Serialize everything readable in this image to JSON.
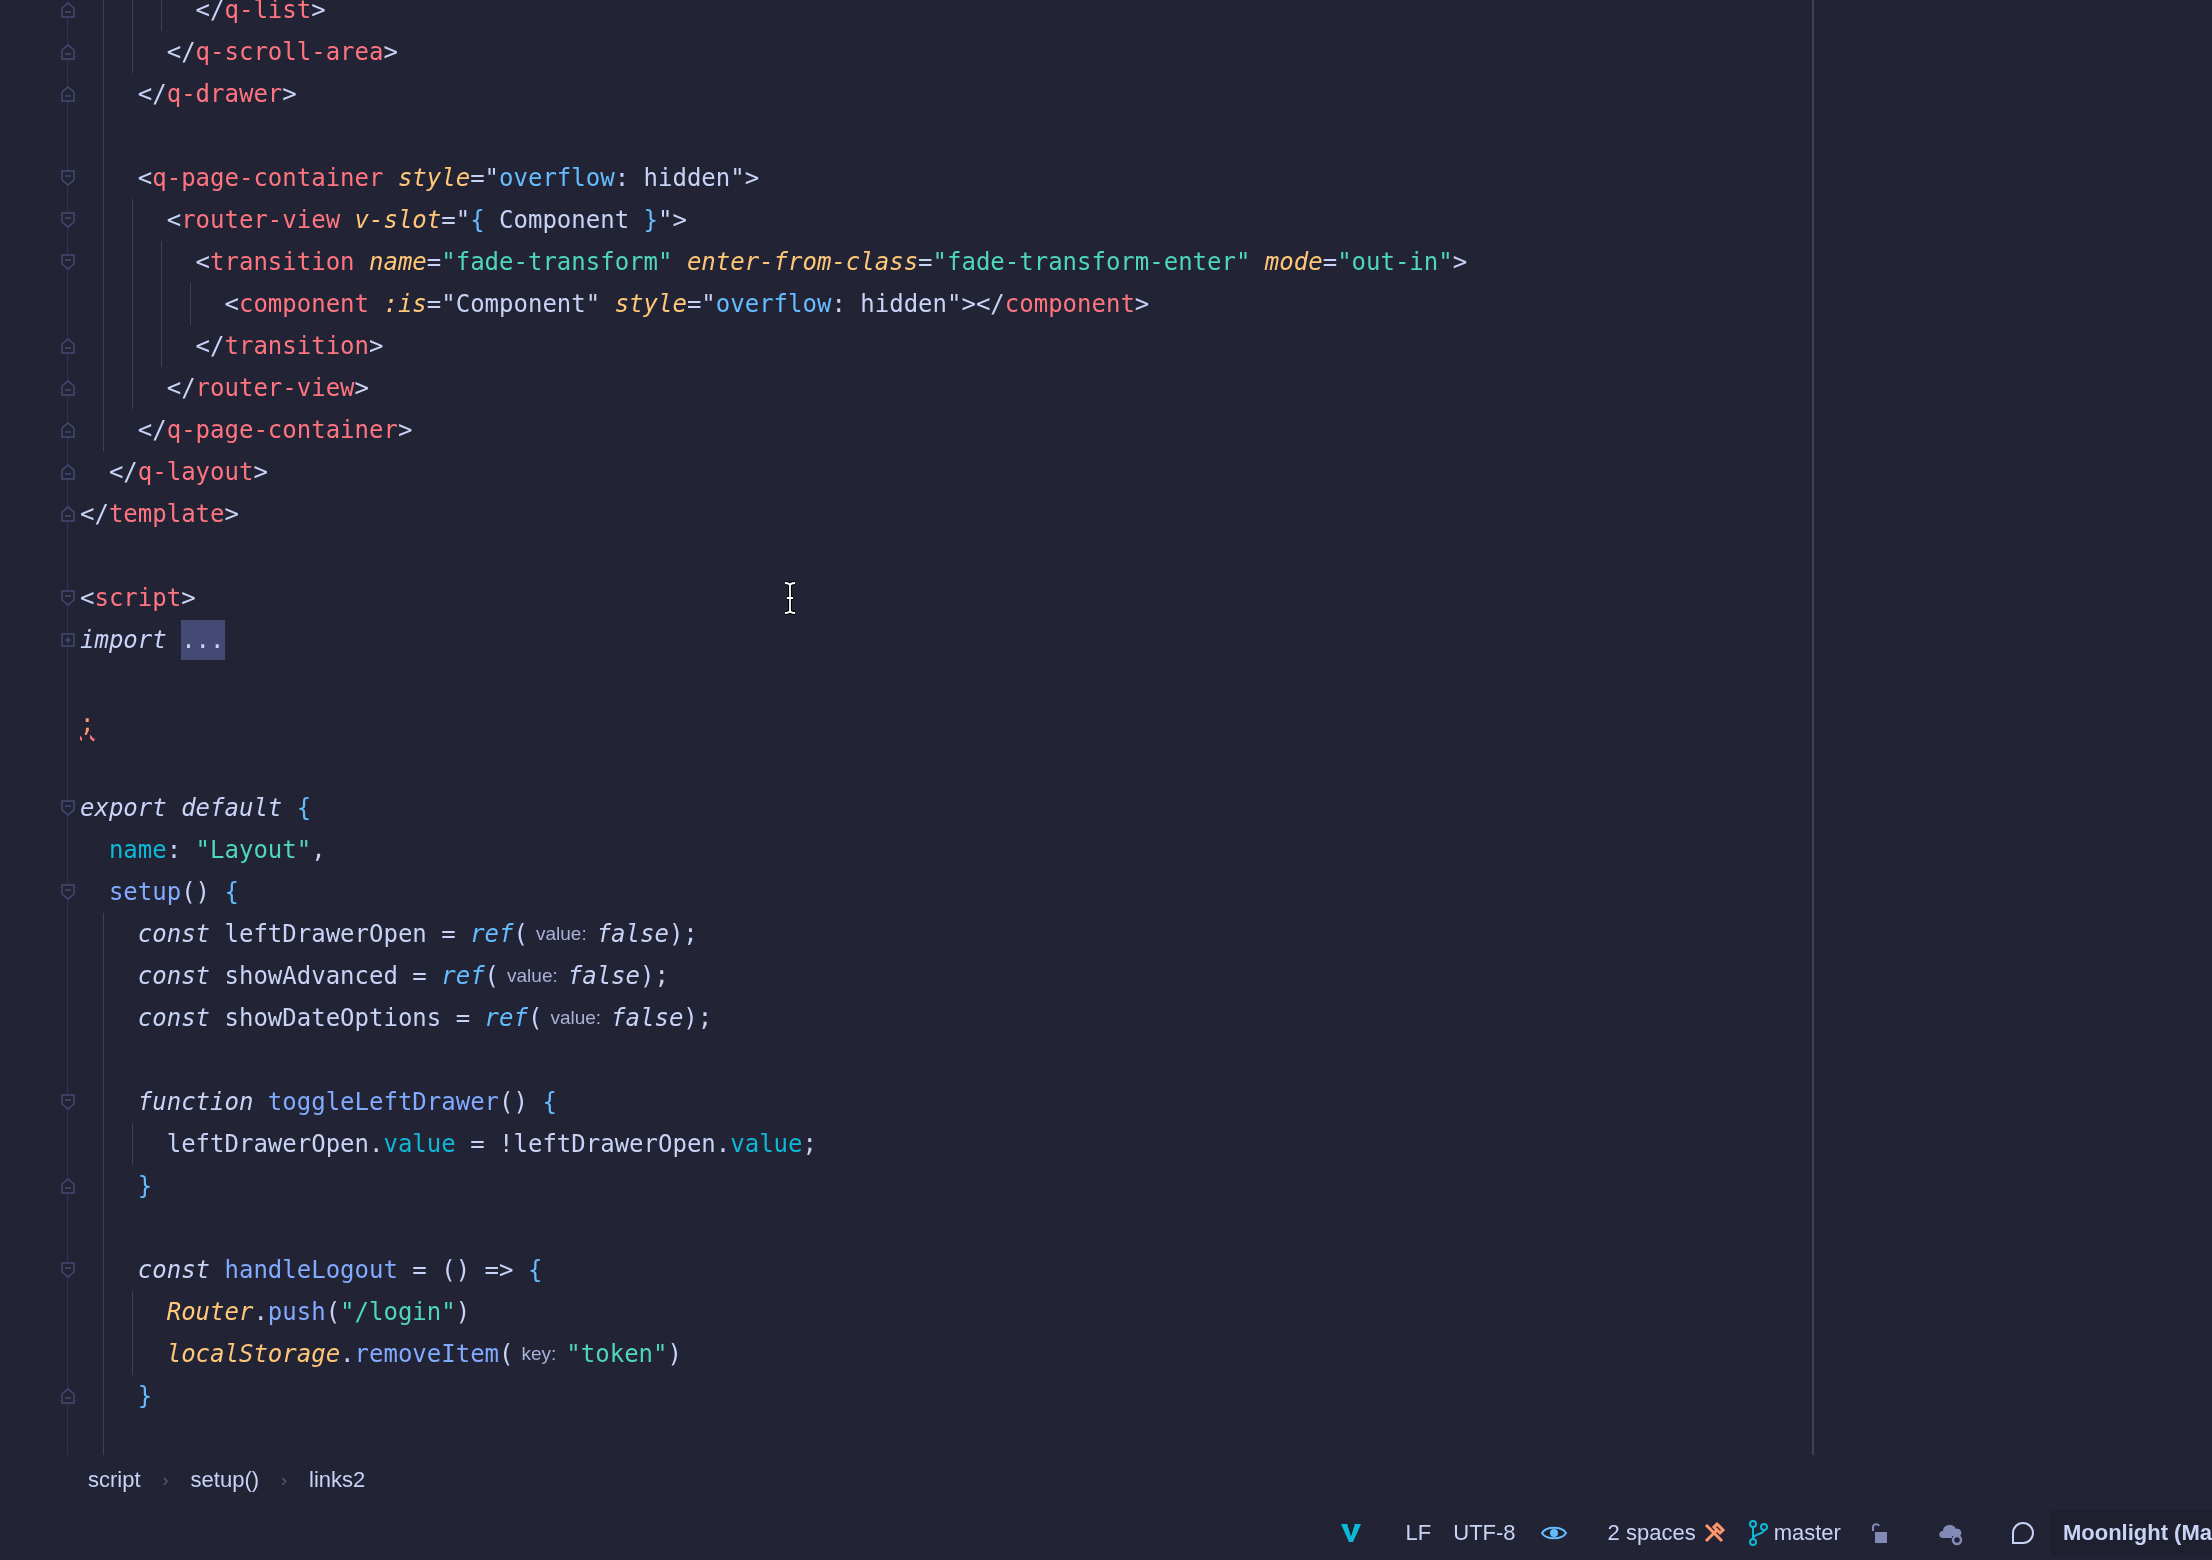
{
  "editor": {
    "lines": [
      {
        "kind": "closer",
        "tokens": [
          {
            "kind": "punct",
            "text": "        </"
          },
          {
            "kind": "tag",
            "text": "q-list"
          },
          {
            "kind": "punct",
            "text": ">"
          }
        ]
      },
      {
        "kind": "closer",
        "tokens": [
          {
            "kind": "punct",
            "text": "      </"
          },
          {
            "kind": "tag",
            "text": "q-scroll-area"
          },
          {
            "kind": "punct",
            "text": ">"
          }
        ]
      },
      {
        "kind": "closer",
        "tokens": [
          {
            "kind": "punct",
            "text": "    </"
          },
          {
            "kind": "tag",
            "text": "q-drawer"
          },
          {
            "kind": "punct",
            "text": ">"
          }
        ]
      },
      {
        "kind": "blank"
      },
      {
        "kind": "opener",
        "tokens": [
          {
            "kind": "punct",
            "text": "    <"
          },
          {
            "kind": "tag",
            "text": "q-page-container"
          },
          {
            "kind": "attr",
            "text": " style"
          },
          {
            "kind": "punct",
            "text": "=\""
          },
          {
            "kind": "cssprop",
            "text": "overflow"
          },
          {
            "kind": "plain",
            "text": ": hidden"
          },
          {
            "kind": "punct",
            "text": "\">"
          }
        ]
      },
      {
        "kind": "opener",
        "tokens": [
          {
            "kind": "punct",
            "text": "      <"
          },
          {
            "kind": "tag",
            "text": "router-view"
          },
          {
            "kind": "attr",
            "text": " v-slot"
          },
          {
            "kind": "punct",
            "text": "=\""
          },
          {
            "kind": "brace",
            "text": "{"
          },
          {
            "kind": "plain",
            "text": " Component "
          },
          {
            "kind": "brace",
            "text": "}"
          },
          {
            "kind": "punct",
            "text": "\">"
          }
        ]
      },
      {
        "kind": "opener",
        "tokens": [
          {
            "kind": "punct",
            "text": "        <"
          },
          {
            "kind": "tag",
            "text": "transition"
          },
          {
            "kind": "attr",
            "text": " name"
          },
          {
            "kind": "punct",
            "text": "="
          },
          {
            "kind": "string",
            "text": "\"fade-transform\""
          },
          {
            "kind": "attr",
            "text": " enter-from-class"
          },
          {
            "kind": "punct",
            "text": "="
          },
          {
            "kind": "string",
            "text": "\"fade-transform-enter\""
          },
          {
            "kind": "attr",
            "text": " mode"
          },
          {
            "kind": "punct",
            "text": "="
          },
          {
            "kind": "string",
            "text": "\"out-in\""
          },
          {
            "kind": "punct",
            "text": ">"
          }
        ]
      },
      {
        "kind": "plain",
        "tokens": [
          {
            "kind": "punct",
            "text": "          <"
          },
          {
            "kind": "tag",
            "text": "component"
          },
          {
            "kind": "attr",
            "text": " :is"
          },
          {
            "kind": "punct",
            "text": "="
          },
          {
            "kind": "plain",
            "text": "\"Component\""
          },
          {
            "kind": "attr",
            "text": " style"
          },
          {
            "kind": "punct",
            "text": "=\""
          },
          {
            "kind": "cssprop",
            "text": "overflow"
          },
          {
            "kind": "plain",
            "text": ": hidden"
          },
          {
            "kind": "punct",
            "text": "\"></"
          },
          {
            "kind": "tag",
            "text": "component"
          },
          {
            "kind": "punct",
            "text": ">"
          }
        ]
      },
      {
        "kind": "closer",
        "tokens": [
          {
            "kind": "punct",
            "text": "        </"
          },
          {
            "kind": "tag",
            "text": "transition"
          },
          {
            "kind": "punct",
            "text": ">"
          }
        ]
      },
      {
        "kind": "closer",
        "tokens": [
          {
            "kind": "punct",
            "text": "      </"
          },
          {
            "kind": "tag",
            "text": "router-view"
          },
          {
            "kind": "punct",
            "text": ">"
          }
        ]
      },
      {
        "kind": "closer",
        "tokens": [
          {
            "kind": "punct",
            "text": "    </"
          },
          {
            "kind": "tag",
            "text": "q-page-container"
          },
          {
            "kind": "punct",
            "text": ">"
          }
        ]
      },
      {
        "kind": "closer",
        "tokens": [
          {
            "kind": "punct",
            "text": "  </"
          },
          {
            "kind": "tag",
            "text": "q-layout"
          },
          {
            "kind": "punct",
            "text": ">"
          }
        ]
      },
      {
        "kind": "closer",
        "tokens": [
          {
            "kind": "punct",
            "text": "</"
          },
          {
            "kind": "tag",
            "text": "template"
          },
          {
            "kind": "punct",
            "text": ">"
          }
        ]
      },
      {
        "kind": "blank"
      },
      {
        "kind": "opener",
        "tokens": [
          {
            "kind": "punct",
            "text": "<"
          },
          {
            "kind": "tag",
            "text": "script"
          },
          {
            "kind": "punct",
            "text": ">"
          }
        ]
      },
      {
        "kind": "collapsed",
        "tokens": [
          {
            "kind": "keyword",
            "text": "import "
          },
          {
            "kind": "folded",
            "text": "..."
          }
        ]
      },
      {
        "kind": "blank"
      },
      {
        "kind": "plain",
        "tokens": [
          {
            "kind": "error",
            "text": ";"
          }
        ]
      },
      {
        "kind": "blank"
      },
      {
        "kind": "opener",
        "tokens": [
          {
            "kind": "keyword",
            "text": "export default "
          },
          {
            "kind": "brace",
            "text": "{"
          }
        ]
      },
      {
        "kind": "plain",
        "tokens": [
          {
            "kind": "property",
            "text": "  name"
          },
          {
            "kind": "punct",
            "text": ": "
          },
          {
            "kind": "string",
            "text": "\"Layout\""
          },
          {
            "kind": "punct",
            "text": ","
          }
        ]
      },
      {
        "kind": "opener",
        "tokens": [
          {
            "kind": "function",
            "text": "  setup"
          },
          {
            "kind": "punct",
            "text": "() "
          },
          {
            "kind": "brace",
            "text": "{"
          }
        ]
      },
      {
        "kind": "plain",
        "tokens": [
          {
            "kind": "keyword",
            "text": "    const"
          },
          {
            "kind": "plain",
            "text": " leftDrawerOpen = "
          },
          {
            "kind": "call",
            "text": "ref"
          },
          {
            "kind": "punct",
            "text": "("
          },
          {
            "kind": "hint",
            "text": "value:"
          },
          {
            "kind": "literal",
            "text": "false"
          },
          {
            "kind": "punct",
            "text": ");"
          }
        ]
      },
      {
        "kind": "plain",
        "tokens": [
          {
            "kind": "keyword",
            "text": "    const"
          },
          {
            "kind": "plain",
            "text": " showAdvanced = "
          },
          {
            "kind": "call",
            "text": "ref"
          },
          {
            "kind": "punct",
            "text": "("
          },
          {
            "kind": "hint",
            "text": "value:"
          },
          {
            "kind": "literal",
            "text": "false"
          },
          {
            "kind": "punct",
            "text": ");"
          }
        ]
      },
      {
        "kind": "plain",
        "tokens": [
          {
            "kind": "keyword",
            "text": "    const"
          },
          {
            "kind": "plain",
            "text": " showDateOptions = "
          },
          {
            "kind": "call",
            "text": "ref"
          },
          {
            "kind": "punct",
            "text": "("
          },
          {
            "kind": "hint",
            "text": "value:"
          },
          {
            "kind": "literal",
            "text": "false"
          },
          {
            "kind": "punct",
            "text": ");"
          }
        ]
      },
      {
        "kind": "blank"
      },
      {
        "kind": "opener",
        "tokens": [
          {
            "kind": "keyword",
            "text": "    function "
          },
          {
            "kind": "function",
            "text": "toggleLeftDrawer"
          },
          {
            "kind": "punct",
            "text": "() "
          },
          {
            "kind": "brace",
            "text": "{"
          }
        ]
      },
      {
        "kind": "plain",
        "tokens": [
          {
            "kind": "plain",
            "text": "      leftDrawerOpen."
          },
          {
            "kind": "property",
            "text": "value"
          },
          {
            "kind": "plain",
            "text": " = !leftDrawerOpen."
          },
          {
            "kind": "property",
            "text": "value"
          },
          {
            "kind": "plain",
            "text": ";"
          }
        ]
      },
      {
        "kind": "closer",
        "tokens": [
          {
            "kind": "brace",
            "text": "    }"
          }
        ]
      },
      {
        "kind": "blank"
      },
      {
        "kind": "opener",
        "tokens": [
          {
            "kind": "keyword",
            "text": "    const "
          },
          {
            "kind": "function",
            "text": "handleLogout"
          },
          {
            "kind": "punct",
            "text": " = () => "
          },
          {
            "kind": "brace",
            "text": "{"
          }
        ]
      },
      {
        "kind": "plain",
        "tokens": [
          {
            "kind": "class",
            "text": "      Router"
          },
          {
            "kind": "punct",
            "text": "."
          },
          {
            "kind": "function",
            "text": "push"
          },
          {
            "kind": "punct",
            "text": "("
          },
          {
            "kind": "string",
            "text": "\"/login\""
          },
          {
            "kind": "punct",
            "text": ")"
          }
        ]
      },
      {
        "kind": "plain",
        "tokens": [
          {
            "kind": "class",
            "text": "      localStorage"
          },
          {
            "kind": "punct",
            "text": "."
          },
          {
            "kind": "function",
            "text": "removeItem"
          },
          {
            "kind": "punct",
            "text": "("
          },
          {
            "kind": "hint",
            "text": "key:"
          },
          {
            "kind": "string",
            "text": "\"token\""
          },
          {
            "kind": "punct",
            "text": ")"
          }
        ]
      },
      {
        "kind": "closer",
        "tokens": [
          {
            "kind": "brace",
            "text": "    }"
          }
        ]
      },
      {
        "kind": "blank"
      }
    ]
  },
  "breadcrumbs": [
    {
      "label": "script",
      "separator": "›"
    },
    {
      "label": "setup()",
      "separator": "›"
    },
    {
      "label": "links2"
    }
  ],
  "status_bar": {
    "line_ending": "LF",
    "encoding": "UTF-8",
    "indentation": "2 spaces",
    "branch": "master",
    "theme": "Moonlight (Ma"
  }
}
